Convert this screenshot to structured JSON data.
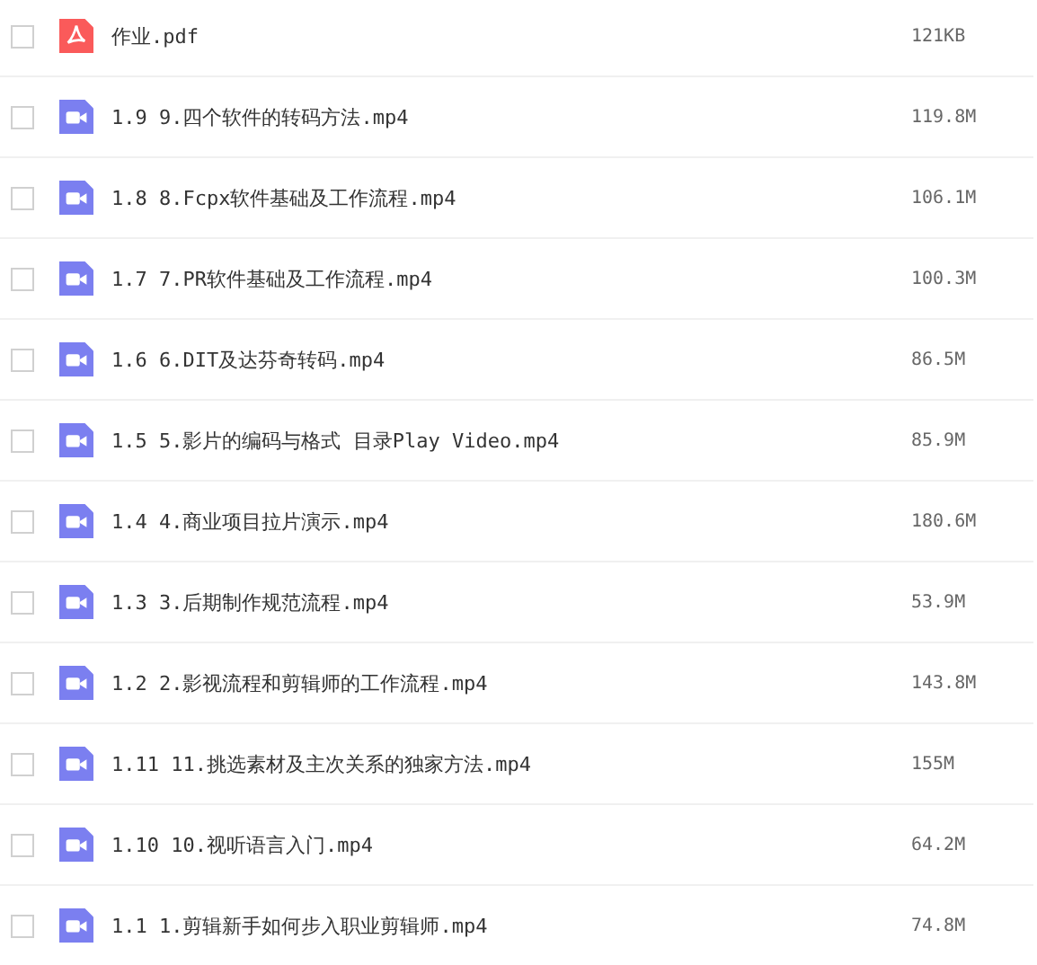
{
  "files": [
    {
      "kind": "pdf",
      "name": "作业.pdf",
      "size": "121KB",
      "checked": false
    },
    {
      "kind": "video",
      "name": "1.9 9.四个软件的转码方法.mp4",
      "size": "119.8M",
      "checked": false
    },
    {
      "kind": "video",
      "name": "1.8 8.Fcpx软件基础及工作流程.mp4",
      "size": "106.1M",
      "checked": false
    },
    {
      "kind": "video",
      "name": "1.7 7.PR软件基础及工作流程.mp4",
      "size": "100.3M",
      "checked": false
    },
    {
      "kind": "video",
      "name": "1.6 6.DIT及达芬奇转码.mp4",
      "size": "86.5M",
      "checked": false
    },
    {
      "kind": "video",
      "name": "1.5 5.影片的编码与格式 目录Play Video.mp4",
      "size": "85.9M",
      "checked": false
    },
    {
      "kind": "video",
      "name": "1.4 4.商业项目拉片演示.mp4",
      "size": "180.6M",
      "checked": false
    },
    {
      "kind": "video",
      "name": "1.3 3.后期制作规范流程.mp4",
      "size": "53.9M",
      "checked": false
    },
    {
      "kind": "video",
      "name": "1.2 2.影视流程和剪辑师的工作流程.mp4",
      "size": "143.8M",
      "checked": false
    },
    {
      "kind": "video",
      "name": "1.11 11.挑选素材及主次关系的独家方法.mp4",
      "size": "155M",
      "checked": false
    },
    {
      "kind": "video",
      "name": "1.10 10.视听语言入门.mp4",
      "size": "64.2M",
      "checked": false
    },
    {
      "kind": "video",
      "name": "1.1 1.剪辑新手如何步入职业剪辑师.mp4",
      "size": "74.8M",
      "checked": false
    }
  ]
}
